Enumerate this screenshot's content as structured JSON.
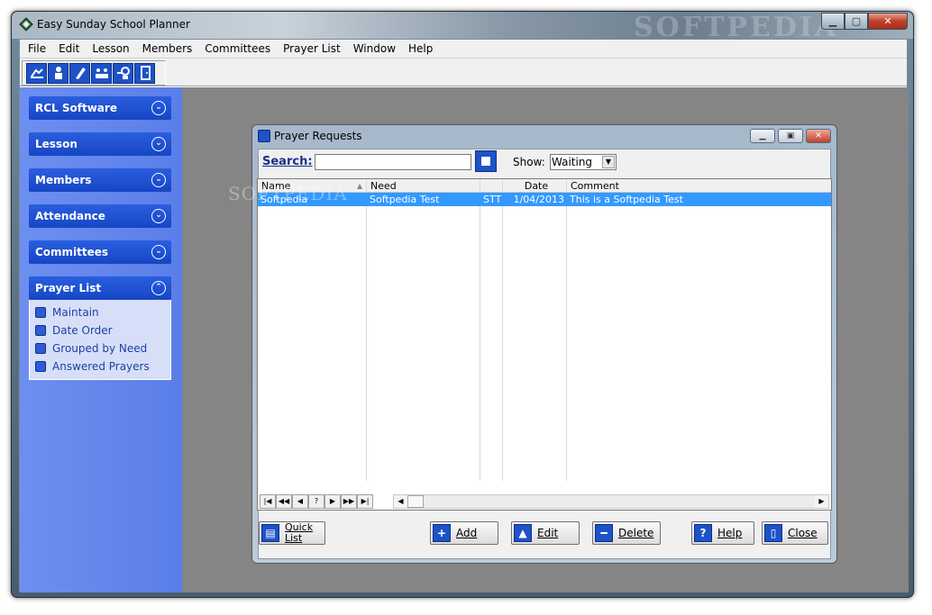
{
  "window": {
    "title": "Easy Sunday School Planner",
    "watermark": "SOFTPEDIA"
  },
  "menu": [
    "File",
    "Edit",
    "Lesson",
    "Members",
    "Committees",
    "Prayer List",
    "Window",
    "Help"
  ],
  "toolbar": {
    "icons": [
      "prayer-hands-icon",
      "member-icon",
      "lesson-icon",
      "attendance-icon",
      "committees-icon",
      "exit-door-icon"
    ]
  },
  "sidebar": {
    "panels": [
      {
        "label": "RCL Software"
      },
      {
        "label": "Lesson"
      },
      {
        "label": "Members"
      },
      {
        "label": "Attendance"
      },
      {
        "label": "Committees"
      },
      {
        "label": "Prayer List",
        "items": [
          "Maintain",
          "Date Order",
          "Grouped by Need",
          "Answered Prayers"
        ]
      }
    ]
  },
  "dialog": {
    "title": "Prayer Requests",
    "search_label": "Search:",
    "search_value": "",
    "show_label": "Show:",
    "show_value": "Waiting",
    "columns": [
      "Name",
      "Need",
      "",
      "Date",
      "Comment"
    ],
    "rows": [
      {
        "name": "Softpedia",
        "need": "Softpedia Test",
        "code": "STT",
        "date": "1/04/2013",
        "comment": "This is a Softpedia Test"
      }
    ],
    "nav_buttons": [
      "|◀",
      "◀◀",
      "◀",
      "?",
      "▶",
      "▶▶",
      "▶|"
    ],
    "buttons": {
      "quick_list_line1": "Quick",
      "quick_list_line2": "List",
      "add": "Add",
      "edit": "Edit",
      "delete": "Delete",
      "help": "Help",
      "close": "Close"
    }
  },
  "watermark_text": "SOFTPEDIA"
}
